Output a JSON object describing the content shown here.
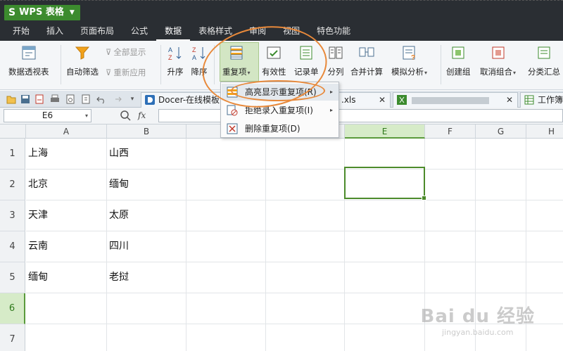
{
  "app": {
    "title": "WPS 表格"
  },
  "menu": {
    "tabs": [
      "开始",
      "插入",
      "页面布局",
      "公式",
      "数据",
      "表格样式",
      "审阅",
      "视图",
      "特色功能"
    ],
    "active": "数据"
  },
  "ribbon": {
    "pivot": "数据透视表",
    "autofilter": "自动筛选",
    "show_all": "全部显示",
    "reapply": "重新应用",
    "sort_asc": "升序",
    "sort_desc": "降序",
    "duplicates": "重复项",
    "validity": "有效性",
    "record": "记录单",
    "split": "分列",
    "consolidate": "合并计算",
    "simulation": "模拟分析",
    "group": "创建组",
    "ungroup": "取消组合",
    "subtotal": "分类汇总"
  },
  "tabs": {
    "docer": "Docer-在线模板",
    "file_suffix": ".xls",
    "workbook": "工作簿"
  },
  "formula_bar": {
    "cell_ref": "E6",
    "fx": "fx"
  },
  "dropdown": {
    "items": [
      "高亮显示重复项(R)",
      "拒绝录入重复项(I)",
      "删除重复项(D)"
    ]
  },
  "grid": {
    "columns": [
      "A",
      "B",
      "C",
      "D",
      "E",
      "F",
      "G",
      "H"
    ],
    "rows": [
      "1",
      "2",
      "3",
      "4",
      "5",
      "6",
      "7"
    ],
    "cells": {
      "A1": "上海",
      "B1": "山西",
      "A2": "北京",
      "B2": "缅甸",
      "A3": "天津",
      "B3": "太原",
      "A4": "云南",
      "B4": "四川",
      "A5": "缅甸",
      "B5": "老挝"
    },
    "selected_col": "E",
    "selected_row": "6"
  },
  "watermark": {
    "main": "Bai du 经验",
    "sub": "jingyan.baidu.com"
  },
  "colors": {
    "accent_green": "#4c8b2b",
    "annotation_orange": "#e8893a",
    "titlebar": "#2a2e33"
  }
}
